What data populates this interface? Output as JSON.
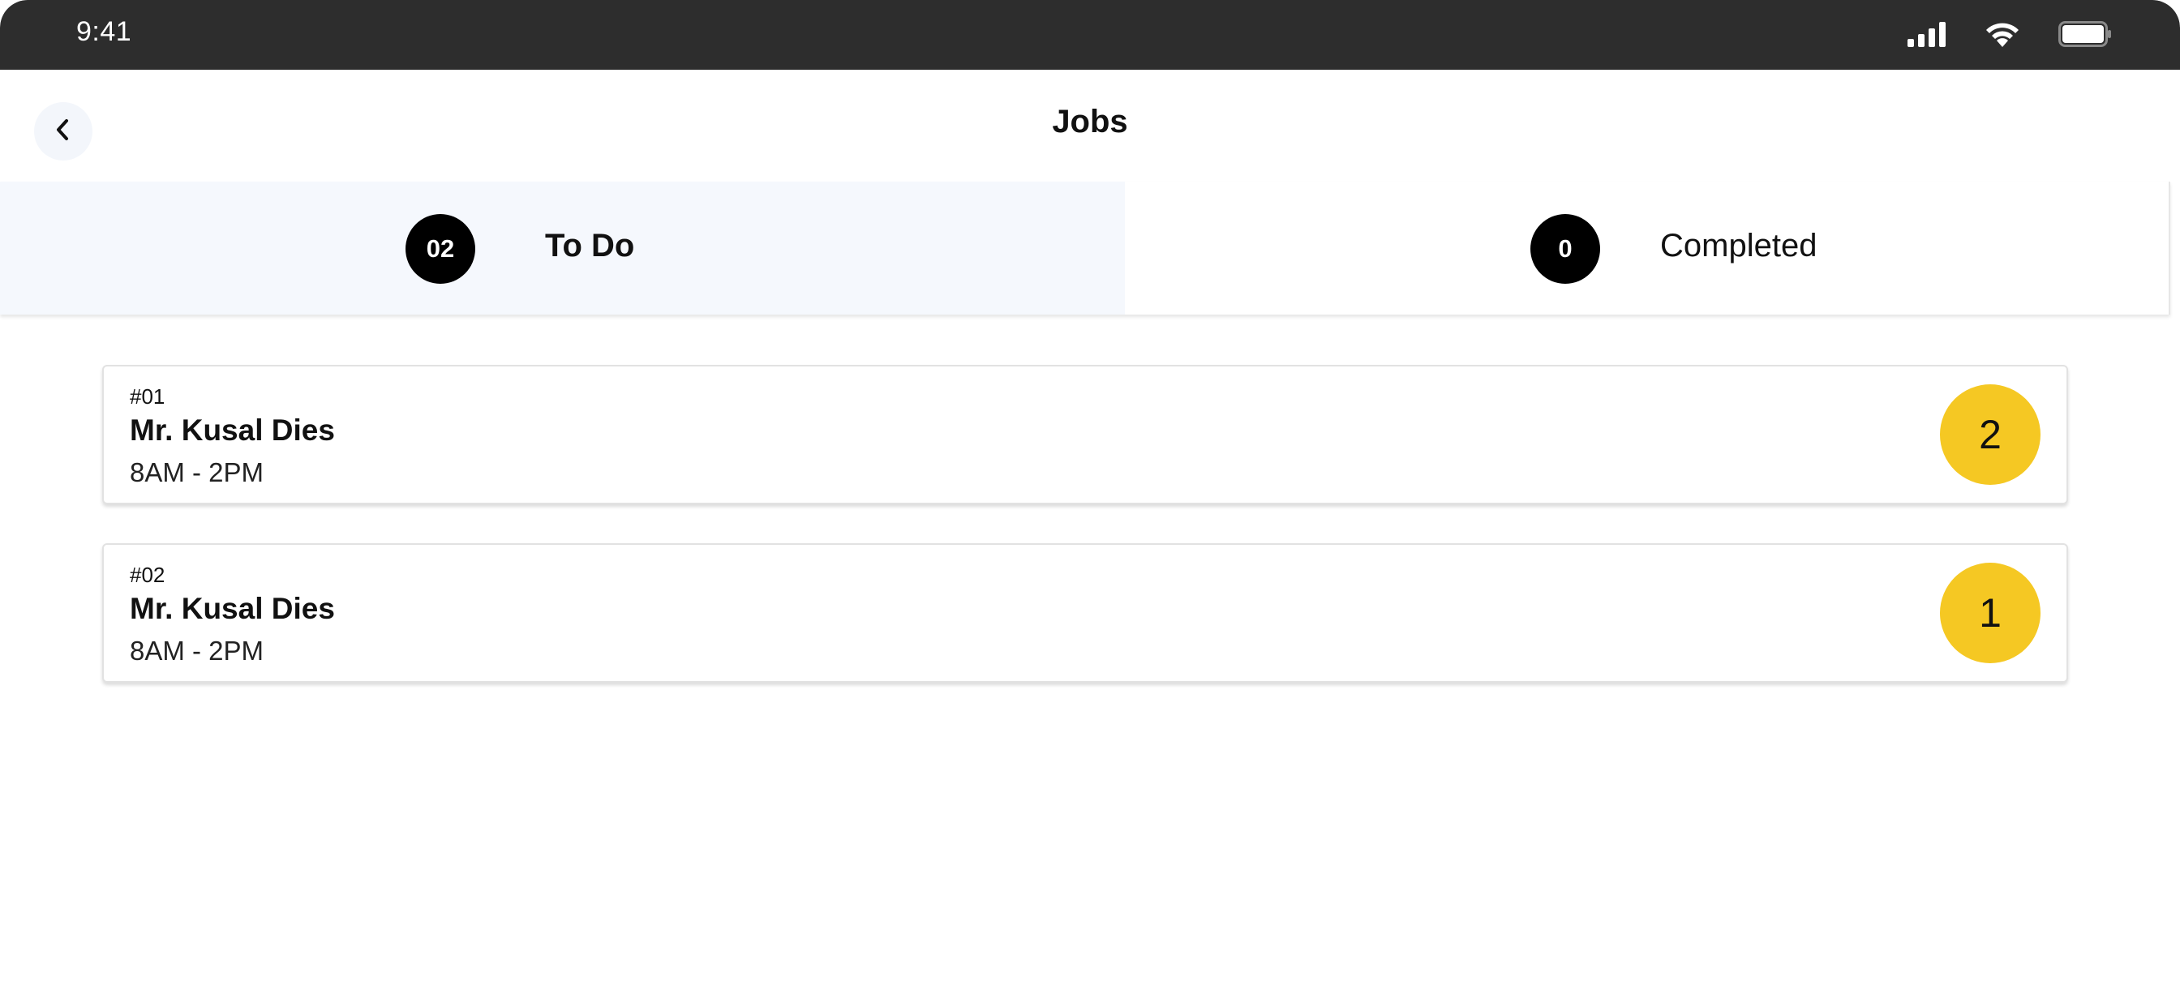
{
  "status_bar": {
    "time": "9:41"
  },
  "header": {
    "title": "Jobs",
    "back_icon": "chevron-left-icon"
  },
  "tabs": [
    {
      "count": "02",
      "label": "To Do",
      "active": true
    },
    {
      "count": "0",
      "label": "Completed",
      "active": false
    }
  ],
  "jobs": [
    {
      "number": "#01",
      "name": "Mr. Kusal Dies",
      "time": "8AM - 2PM",
      "badge": "2"
    },
    {
      "number": "#02",
      "name": "Mr. Kusal Dies",
      "time": "8AM - 2PM",
      "badge": "1"
    }
  ],
  "colors": {
    "status_bar_bg": "#2d2d2d",
    "active_tab_bg": "#f5f8fd",
    "badge_yellow": "#f5c823",
    "count_bubble": "#000000"
  }
}
